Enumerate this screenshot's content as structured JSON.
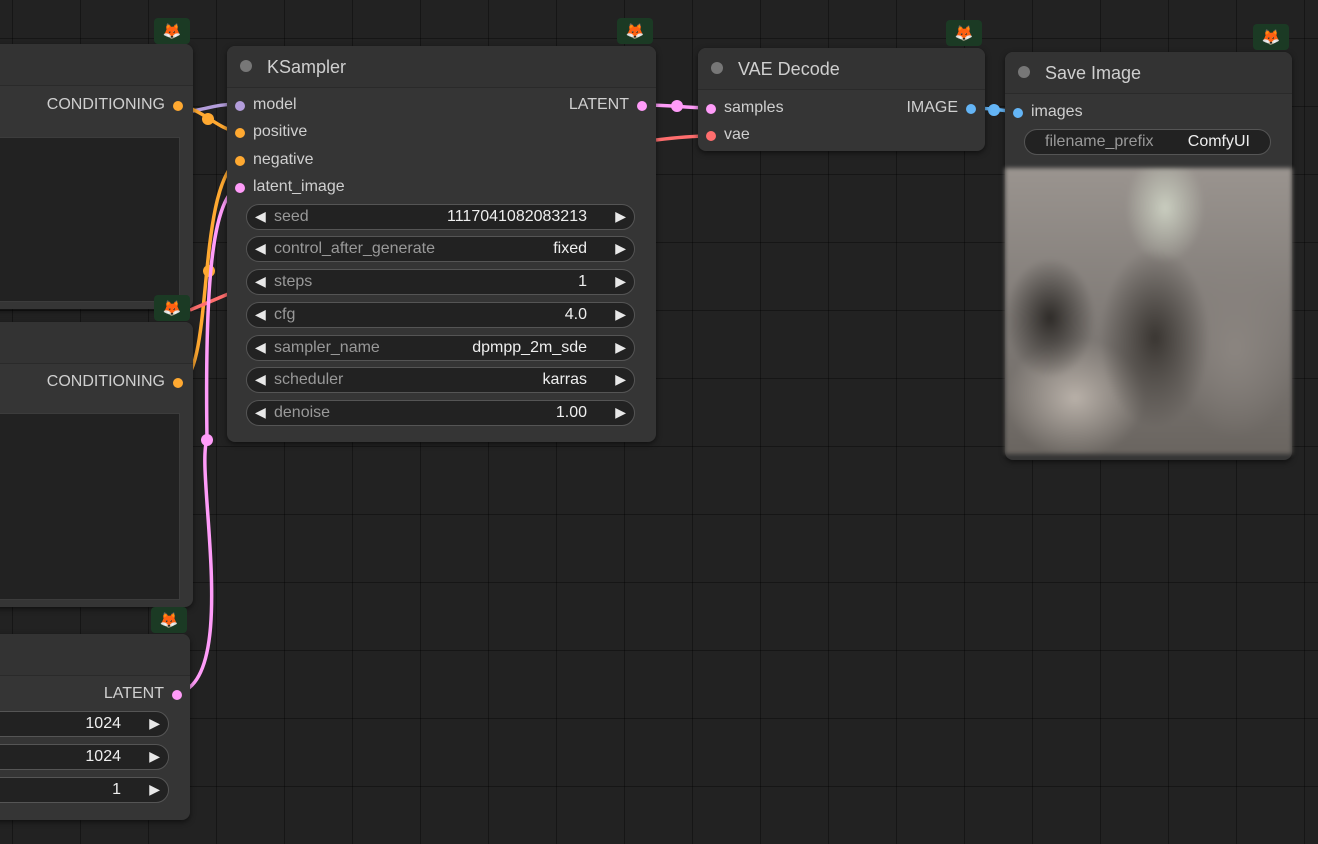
{
  "colors": {
    "model": "#b39ddb",
    "conditioning": "#ffa931",
    "latent": "#ff9cf9",
    "vae": "#ff6e6e",
    "image": "#64b5f6"
  },
  "badge_icon": "fox-icon",
  "left_nodes": {
    "positive_encode": {
      "output_label": "CONDITIONING"
    },
    "negative_encode": {
      "output_label": "CONDITIONING"
    },
    "empty_latent": {
      "output_label": "LATENT",
      "widgets": [
        {
          "value": "1024"
        },
        {
          "value": "1024"
        },
        {
          "value": "1"
        }
      ]
    }
  },
  "ksampler": {
    "title": "KSampler",
    "inputs": {
      "model": "model",
      "positive": "positive",
      "negative": "negative",
      "latent_image": "latent_image"
    },
    "output_label": "LATENT",
    "widgets": [
      {
        "name": "seed",
        "value": "1117041082083213"
      },
      {
        "name": "control_after_generate",
        "value": "fixed"
      },
      {
        "name": "steps",
        "value": "1"
      },
      {
        "name": "cfg",
        "value": "4.0"
      },
      {
        "name": "sampler_name",
        "value": "dpmpp_2m_sde"
      },
      {
        "name": "scheduler",
        "value": "karras"
      },
      {
        "name": "denoise",
        "value": "1.00"
      }
    ]
  },
  "vae_decode": {
    "title": "VAE Decode",
    "inputs": {
      "samples": "samples",
      "vae": "vae"
    },
    "output_label": "IMAGE"
  },
  "save_image": {
    "title": "Save Image",
    "input_label": "images",
    "widget": {
      "name": "filename_prefix",
      "value": "ComfyUI"
    }
  }
}
